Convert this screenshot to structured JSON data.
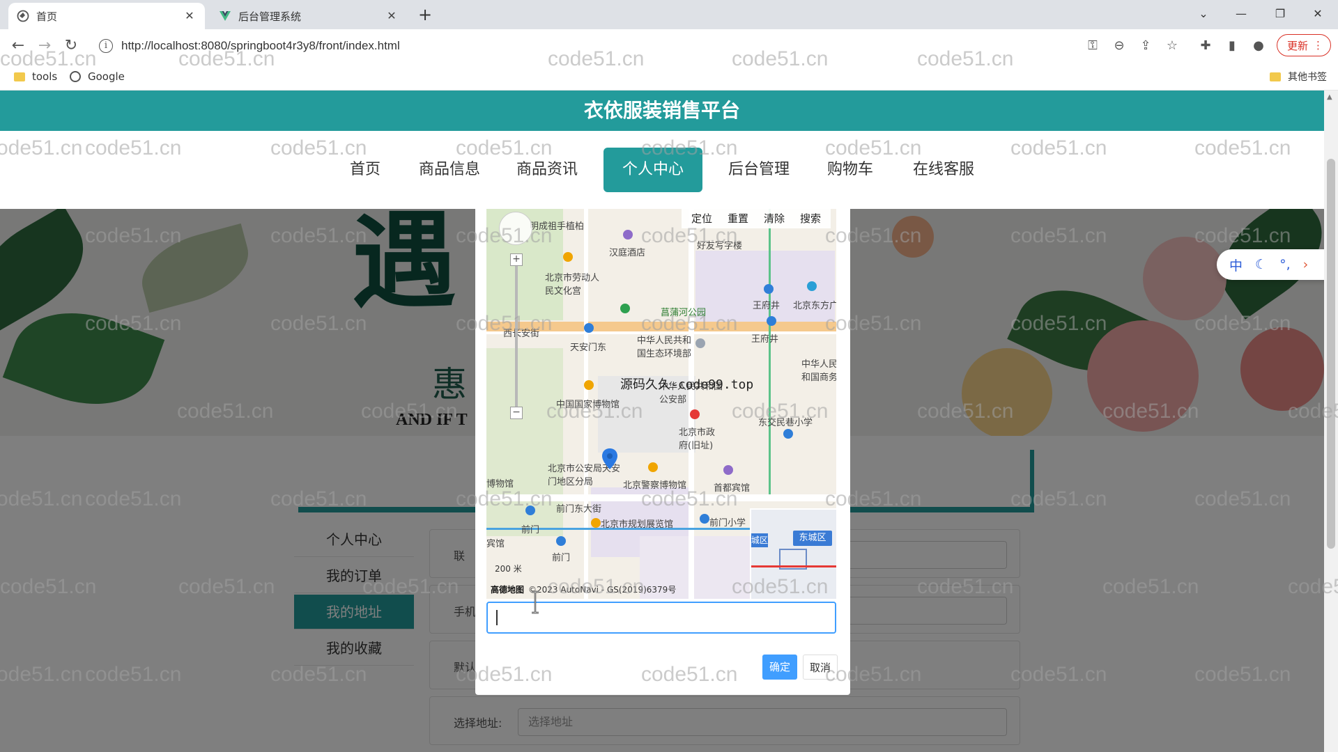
{
  "browser": {
    "tabs": [
      {
        "title": "首页",
        "active": true
      },
      {
        "title": "后台管理系统",
        "active": false
      }
    ],
    "url": "http://localhost:8080/springboot4r3y8/front/index.html",
    "update_label": "更新",
    "bookmarks": [
      {
        "label": "tools"
      },
      {
        "label": "Google"
      }
    ],
    "other_bookmarks": "其他书签"
  },
  "site": {
    "title": "衣依服装销售平台",
    "nav": [
      "首页",
      "商品信息",
      "商品资讯",
      "个人中心",
      "后台管理",
      "购物车",
      "在线客服"
    ],
    "active_nav": "个人中心"
  },
  "banner": {
    "big_char": "遇",
    "sub_char": "惠",
    "and_text": "AND IF T",
    "small_text": "IF"
  },
  "side_menu": {
    "items": [
      "个人中心",
      "我的订单",
      "我的地址",
      "我的收藏"
    ],
    "active": "我的地址"
  },
  "form": {
    "label_lianxi": "联",
    "label_phone": "手机",
    "label_default": "默认",
    "label_select_addr": "选择地址:",
    "select_addr_placeholder": "选择地址"
  },
  "map_dialog": {
    "toolbar": [
      "定位",
      "重置",
      "清除",
      "搜索"
    ],
    "center_watermark": "源码久久-code99.top",
    "labels": {
      "street1": "明成祖手植柏",
      "hotel1": "汉庭酒店",
      "office": "好友写字楼",
      "palace": "北京市劳动人民文化宫",
      "park": "菖蒲河公园",
      "wangfujing": "王府井",
      "dongfang": "北京东方广",
      "xichang": "西长安街",
      "tiananmen_east": "天安门东",
      "ministry": "中华人民共和国生态环境部",
      "museum": "中国国家博物馆",
      "security_ministry": "中华人民共和国公安部",
      "beijing_gov": "北京市政府(旧址)",
      "dongjiaominxiang": "东交民巷小学",
      "china_people_comm": "中华人民和国商务",
      "police_bureau": "北京市公安局天安门地区分局",
      "police_museum": "北京警察博物馆",
      "capital_hotel": "首都宾馆",
      "museum_w": "博物馆",
      "qianmen_east": "前门东大街",
      "qianmen": "前门",
      "planning_hall": "北京市规划展览馆",
      "qianmen_school": "前门小学",
      "hotel_w": "宾馆",
      "qianmen2": "前门",
      "dongcheng": "东城区",
      "district_w": "城区"
    },
    "scale": "200 米",
    "logo_text": "高德地图",
    "copyright": "©2023 AutoNavi - GS(2019)6379号",
    "address_value": "",
    "ok_label": "确定",
    "cancel_label": "取消"
  },
  "ime": {
    "items": [
      "中",
      "☾",
      "°,",
      "›"
    ]
  },
  "watermark_text": "code51.cn",
  "colors": {
    "brand": "#239b9b",
    "primary_button": "#409eff"
  }
}
